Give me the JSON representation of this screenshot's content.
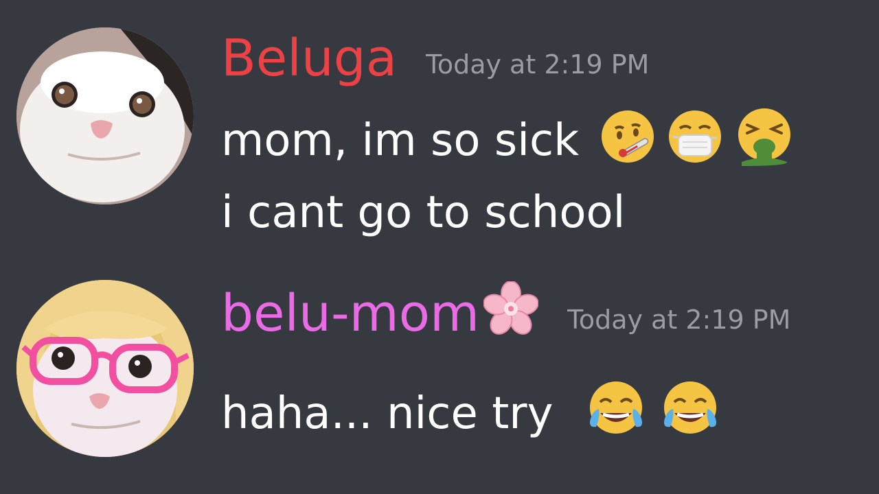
{
  "messages": [
    {
      "username": "Beluga",
      "username_color": "#ed4245",
      "timestamp": "Today at 2:19 PM",
      "lines": [
        "mom, im so sick",
        "i cant go to school"
      ],
      "emojis": [
        "thermometer-face-icon",
        "mask-face-icon",
        "vomit-face-icon"
      ]
    },
    {
      "username": "belu-mom",
      "username_color": "#eb6be6",
      "badge": "cherry-blossom-icon",
      "timestamp": "Today at 2:19 PM",
      "lines": [
        "haha... nice try"
      ],
      "emojis": [
        "tears-of-joy-icon",
        "tears-of-joy-icon"
      ]
    }
  ],
  "colors": {
    "background": "#36393f",
    "text": "#ffffff",
    "timestamp": "#9a9da4"
  }
}
